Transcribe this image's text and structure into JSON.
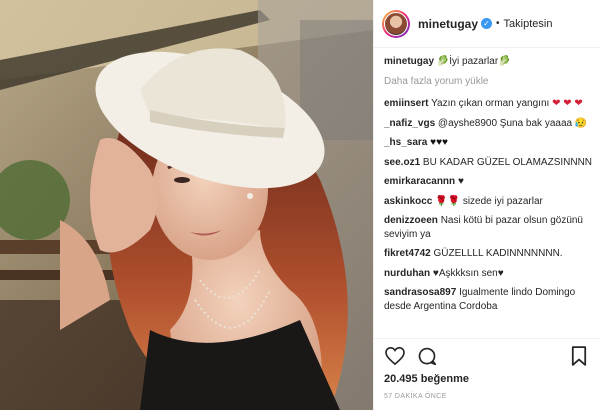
{
  "post": {
    "author": "minetugay",
    "follow_status": "Takiptesin",
    "caption_text": "İyi pazarlar",
    "caption_emoji_left": "🥬",
    "caption_emoji_right": "🥬",
    "load_more": "Daha fazla yorum yükle"
  },
  "comments": [
    {
      "user": "emiinsert",
      "text": "Yazın çıkan orman yangını",
      "suffix": "❤ ❤ ❤"
    },
    {
      "user": "_nafiz_vgs",
      "text": "@ayshe8900 Şuna bak yaaaa",
      "suffix": "😥"
    },
    {
      "user": "_hs_sara",
      "text": "",
      "suffix": "♥♥♥"
    },
    {
      "user": "see.oz1",
      "text": "BU KADAR GÜZEL OLAMAZSINNNN",
      "suffix": ""
    },
    {
      "user": "emirkaracannn",
      "text": "♥",
      "suffix": ""
    },
    {
      "user": "askinkocc",
      "text": "🌹🌹 sizede iyi pazarlar",
      "suffix": ""
    },
    {
      "user": "denizzoeen",
      "text": "Nasi kötü bi pazar olsun gözünü seviyim ya",
      "suffix": ""
    },
    {
      "user": "fikret4742",
      "text": "GÜZELLLL KADINNNNNNN.",
      "suffix": ""
    },
    {
      "user": "nurduhan",
      "text": "♥Aşkkksın sen♥",
      "suffix": ""
    },
    {
      "user": "sandrasosa897",
      "text": "Igualmente lindo Domingo desde Argentina Cordoba",
      "suffix": ""
    }
  ],
  "footer": {
    "likes": "20.495 beğenme",
    "time": "57 DAKİKA ÖNCE"
  },
  "icons": {
    "like": "heart-outline-icon",
    "comment": "comment-bubble-icon",
    "save": "bookmark-icon",
    "verified": "verified-check-icon",
    "more": "ellipsis-icon"
  },
  "colors": {
    "verified": "#3897f0",
    "heart": "#d4213a",
    "muted": "#999999",
    "text": "#262626"
  }
}
